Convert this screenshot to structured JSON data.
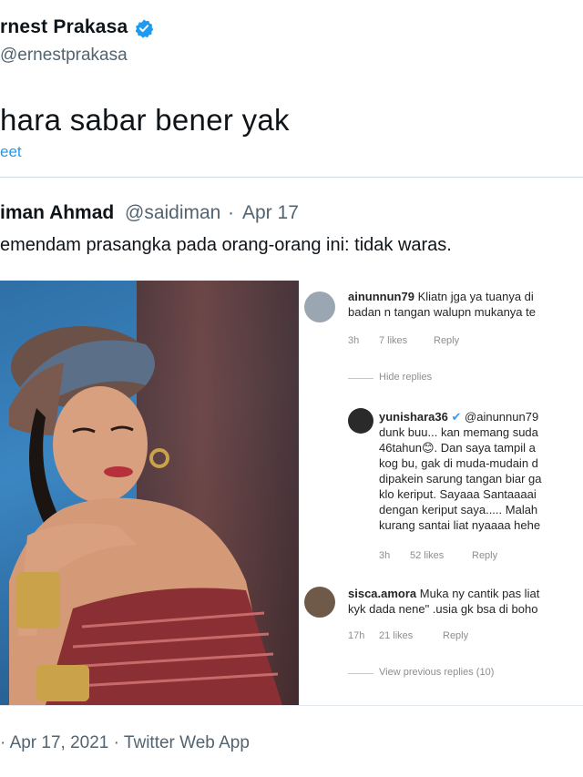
{
  "tweet": {
    "author_name": "rnest Prakasa",
    "author_handle": "@ernestprakasa",
    "text": "hara sabar bener yak",
    "link_text": "eet"
  },
  "quote": {
    "author_name": "iman Ahmad",
    "author_handle": "@saidiman",
    "separator": "·",
    "date": "Apr 17",
    "text": "emendam prasangka pada orang-orang ini: tidak waras."
  },
  "comments": [
    {
      "user": "ainunnun79",
      "lines": [
        "Kliatn jga ya tuanya di",
        "badan n tangan walupn mukanya te"
      ],
      "time": "3h",
      "likes": "7 likes",
      "reply": "Reply"
    },
    {
      "hide_replies": "Hide replies"
    },
    {
      "user": "yunishara36",
      "mention": "@ainunnun79",
      "lines": [
        "dunk buu... kan memang suda",
        "46tahun😊. Dan saya tampil a",
        "kog bu, gak di muda-mudain d",
        "dipakein sarung tangan biar ga",
        "klo keriput.  Sayaaa Santaaaai",
        "dengan keriput saya.....  Malah",
        "kurang santai liat nyaaaa hehe"
      ],
      "time": "3h",
      "likes": "52 likes",
      "reply": "Reply"
    },
    {
      "user": "sisca.amora",
      "lines": [
        "Muka ny cantik pas liat",
        "kyk dada nene\" .usia gk bsa di boho"
      ],
      "time": "17h",
      "likes": "21 likes",
      "reply": "Reply"
    },
    {
      "view_previous": "View previous replies (10)"
    }
  ],
  "footer": {
    "prefix": "·",
    "date": "Apr 17, 2021",
    "separator": "·",
    "source": "Twitter Web App"
  },
  "colors": {
    "link": "#1d9bf0",
    "muted": "#536471",
    "verified": "#1d9bf0"
  }
}
